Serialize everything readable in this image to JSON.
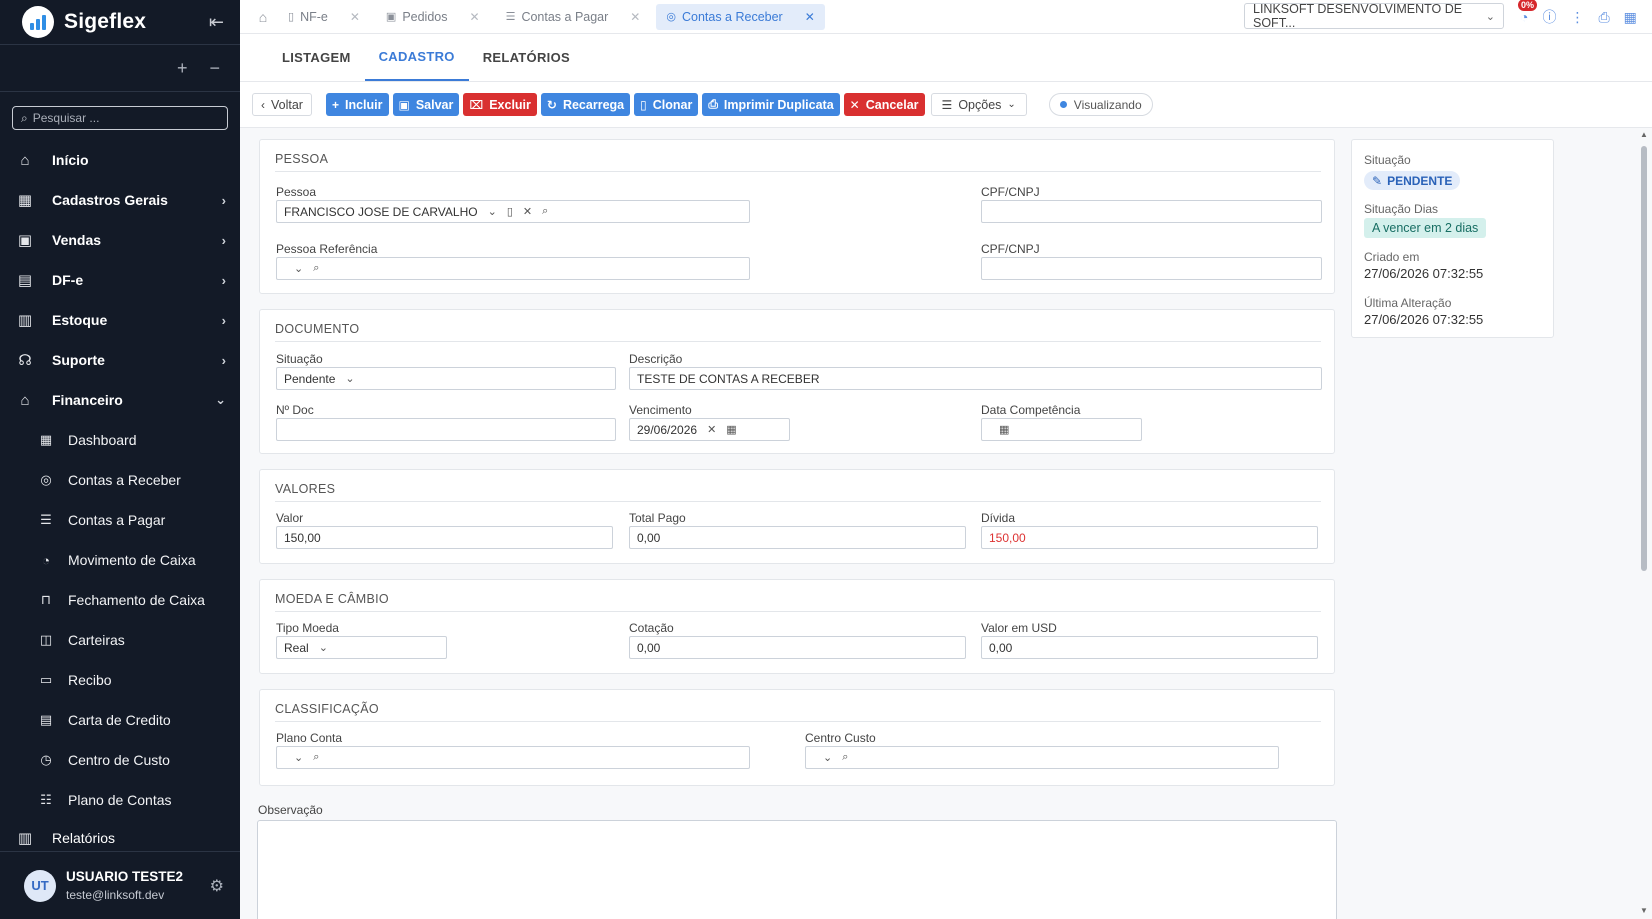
{
  "sidebar": {
    "brand": "Sigeflex",
    "search_placeholder": "Pesquisar ...",
    "items": [
      {
        "label": "Início"
      },
      {
        "label": "Cadastros Gerais"
      },
      {
        "label": "Vendas"
      },
      {
        "label": "DF-e"
      },
      {
        "label": "Estoque"
      },
      {
        "label": "Suporte"
      },
      {
        "label": "Financeiro"
      }
    ],
    "financeiro_sub": [
      {
        "label": "Dashboard"
      },
      {
        "label": "Contas a Receber"
      },
      {
        "label": "Contas a Pagar"
      },
      {
        "label": "Movimento de Caixa"
      },
      {
        "label": "Fechamento de Caixa"
      },
      {
        "label": "Carteiras"
      },
      {
        "label": "Recibo"
      },
      {
        "label": "Carta de Credito"
      },
      {
        "label": "Centro de Custo"
      },
      {
        "label": "Plano de Contas"
      }
    ],
    "relatorios": "Relatórios",
    "user": {
      "initials": "UT",
      "name": "USUARIO TESTE2",
      "email": "teste@linksoft.dev"
    }
  },
  "topbar": {
    "tabs": [
      {
        "label": "NF-e"
      },
      {
        "label": "Pedidos"
      },
      {
        "label": "Contas a Pagar"
      },
      {
        "label": "Contas a Receber"
      }
    ],
    "company": "LINKSOFT DESENVOLVIMENTO DE SOFT...",
    "notification_badge": "0%"
  },
  "subtabs": [
    "LISTAGEM",
    "CADASTRO",
    "RELATÓRIOS"
  ],
  "toolbar": {
    "back": "Voltar",
    "incluir": "Incluir",
    "salvar": "Salvar",
    "excluir": "Excluir",
    "recarrega": "Recarrega",
    "clonar": "Clonar",
    "imprimir": "Imprimir Duplicata",
    "cancelar": "Cancelar",
    "opcoes": "Opções",
    "status": "Visualizando"
  },
  "form": {
    "pessoa": {
      "title": "PESSOA",
      "pessoa_label": "Pessoa",
      "pessoa_value": "FRANCISCO JOSE DE CARVALHO",
      "cpf_label": "CPF/CNPJ",
      "cpf_value": "",
      "ref_label": "Pessoa Referência",
      "ref_value": "",
      "cpf2_label": "CPF/CNPJ",
      "cpf2_value": ""
    },
    "documento": {
      "title": "DOCUMENTO",
      "situacao_label": "Situação",
      "situacao_value": "Pendente",
      "descricao_label": "Descrição",
      "descricao_value": "TESTE DE CONTAS A RECEBER",
      "ndoc_label": "Nº Doc",
      "ndoc_value": "",
      "vencimento_label": "Vencimento",
      "vencimento_value": "29/06/2026",
      "competencia_label": "Data Competência",
      "competencia_value": ""
    },
    "valores": {
      "title": "VALORES",
      "valor_label": "Valor",
      "valor_value": "150,00",
      "pago_label": "Total Pago",
      "pago_value": "0,00",
      "divida_label": "Dívida",
      "divida_value": "150,00"
    },
    "moeda": {
      "title": "MOEDA E CÂMBIO",
      "tipo_label": "Tipo Moeda",
      "tipo_value": "Real",
      "cotacao_label": "Cotação",
      "cotacao_value": "0,00",
      "usd_label": "Valor em USD",
      "usd_value": "0,00"
    },
    "classificacao": {
      "title": "CLASSIFICAÇÃO",
      "plano_label": "Plano Conta",
      "plano_value": "",
      "centro_label": "Centro Custo",
      "centro_value": ""
    },
    "observacao_label": "Observação"
  },
  "info": {
    "situacao_label": "Situação",
    "situacao_badge": "PENDENTE",
    "dias_label": "Situação Dias",
    "dias_badge": "A vencer em 2 dias",
    "criado_label": "Criado em",
    "criado_value": "27/06/2026 07:32:55",
    "alteracao_label": "Última Alteração",
    "alteracao_value": "27/06/2026 07:32:55"
  },
  "colors": {
    "accent": "#3f86e0",
    "danger": "#d93030",
    "sidebar_bg": "#131a27"
  }
}
